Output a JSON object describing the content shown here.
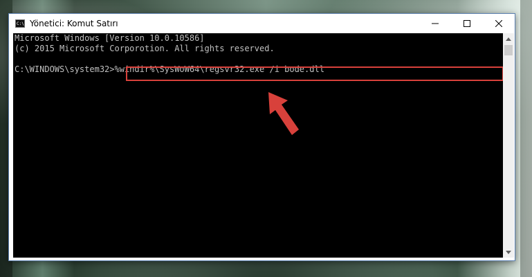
{
  "window": {
    "title": "Yönetici: Komut Satırı",
    "app_icon": "cmd-icon",
    "app_icon_text": "C:\\",
    "controls": {
      "minimize": "minimize-icon",
      "maximize": "maximize-icon",
      "close": "close-icon"
    }
  },
  "console": {
    "lines": [
      "Microsoft Windows [Version 10.0.10586]",
      "(c) 2015 Microsoft Corporotion. All rights reserved.",
      ""
    ],
    "prompt": "C:\\WINDOWS\\system32>",
    "command": "%windir%\\SysWoW64\\regsvr32.exe /i bode.dll"
  },
  "annotation": {
    "highlight_color": "#d8413b",
    "arrow_icon": "arrow-pointer-icon"
  },
  "colors": {
    "console_bg": "#000000",
    "console_text": "#c0c0c0",
    "window_border": "#5a7fb0"
  }
}
